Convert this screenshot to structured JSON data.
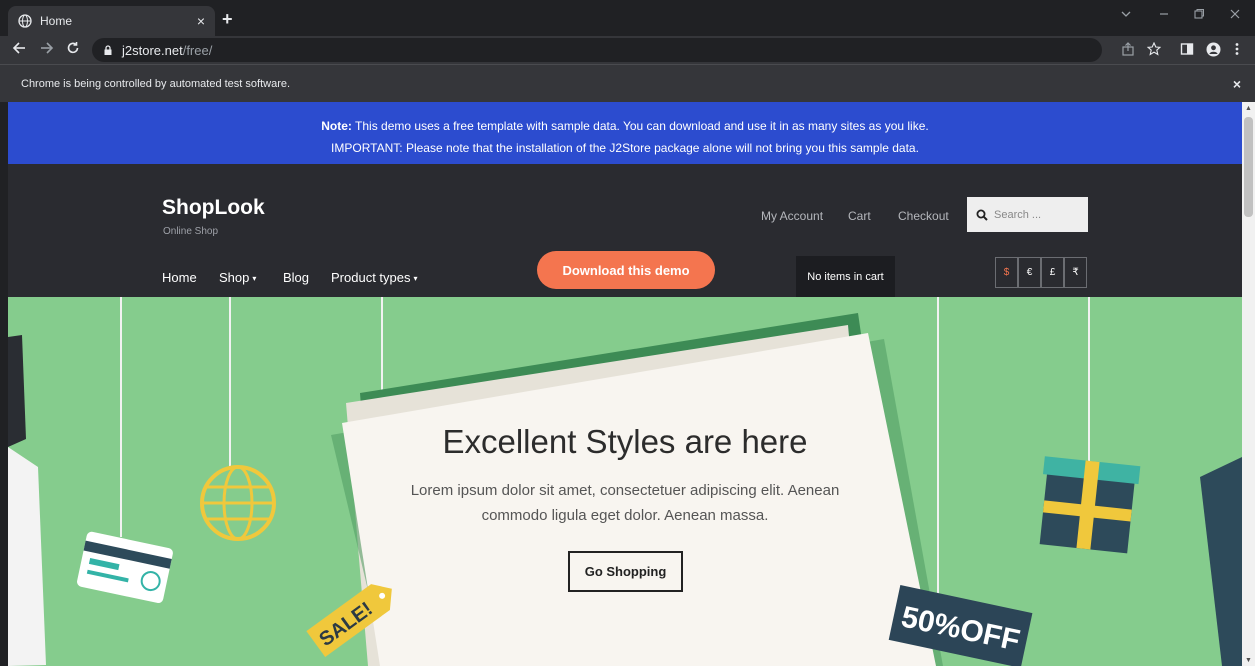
{
  "browser": {
    "tab_title": "Home",
    "url_host": "j2store.net",
    "url_path": "/free/",
    "infobar_text": "Chrome is being controlled by automated test software.",
    "tab_close": "×",
    "new_tab": "+",
    "infobar_close": "×",
    "icons": [
      "globe-icon",
      "back-icon",
      "forward-icon",
      "reload-icon",
      "lock-icon",
      "share-icon",
      "star-icon",
      "side-panel-icon",
      "profile-icon",
      "menu-icon"
    ]
  },
  "notice": {
    "label": "Note:",
    "line1": " This demo uses a free template with sample data. You can download and use it in as many sites as you like.",
    "line2": "IMPORTANT: Please note that the installation of the J2Store package alone will not bring you this sample data."
  },
  "site": {
    "brand": "ShopLook",
    "tagline": "Online Shop",
    "top_links": [
      "My Account",
      "Cart",
      "Checkout"
    ],
    "search_placeholder": "Search ...",
    "nav": [
      "Home",
      "Shop",
      "Blog",
      "Product types"
    ],
    "nav_caret": "▾",
    "download_label": "Download this demo",
    "cart_status": "No items in cart",
    "currencies": [
      "$",
      "€",
      "£",
      "₹"
    ],
    "active_currency": "$",
    "accent_color": "#f4754f",
    "header_color": "#2a2b30",
    "notice_color": "#2c4ccf"
  },
  "hero": {
    "title": "Excellent Styles are here",
    "text": "Lorem ipsum dolor sit amet, consectetuer adipiscing elit. Aenean commodo ligula eget dolor. Aenean massa.",
    "button": "Go Shopping",
    "sale_tag": "SALE!",
    "discount": "50%OFF",
    "background_color": "#85cc8d"
  }
}
